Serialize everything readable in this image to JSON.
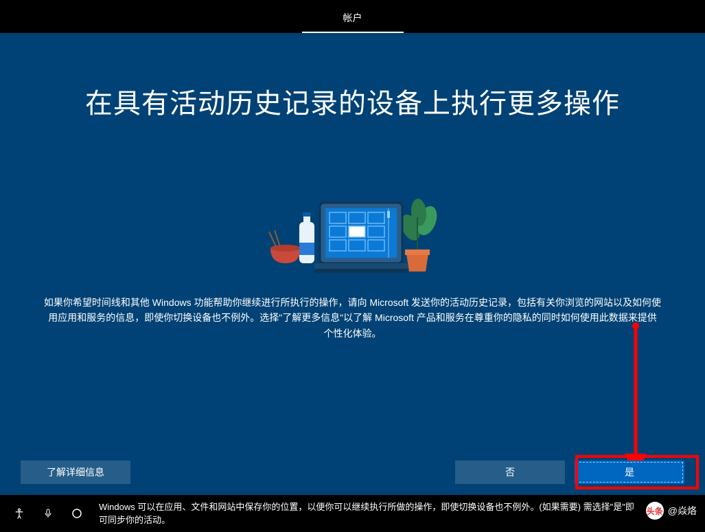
{
  "topbar": {
    "tab_label": "帐户"
  },
  "main": {
    "title": "在具有活动历史记录的设备上执行更多操作",
    "description": "如果你希望时间线和其他 Windows 功能帮助你继续进行所执行的操作，请向 Microsoft 发送你的活动历史记录，包括有关你浏览的网站以及如何使用应用和服务的信息，即使你切换设备也不例外。选择\"了解更多信息\"以了解 Microsoft 产品和服务在尊重你的隐私的同时如何使用此数据来提供个性化体验。"
  },
  "buttons": {
    "learn_more": "了解详细信息",
    "no": "否",
    "yes": "是"
  },
  "footer": {
    "text": "Windows 可以在应用、文件和网站中保存你的位置，以便你可以继续执行所做的操作，即使切换设备也不例外。(如果需要)\n需选择\"是\"即可同步你的活动。"
  },
  "watermark": {
    "prefix": "头条",
    "handle": "@焱烙"
  },
  "icons": {
    "accessibility": "accessibility-icon",
    "microphone": "microphone-icon",
    "circle": "circle-icon"
  },
  "colors": {
    "bg_main": "#004275",
    "accent": "#0067c0",
    "highlight": "#ff0000"
  }
}
